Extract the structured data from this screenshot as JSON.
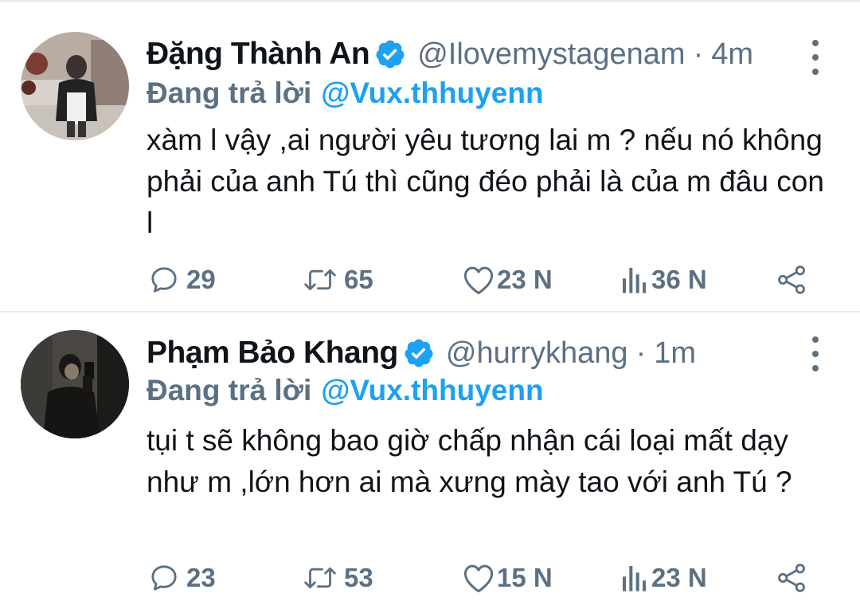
{
  "tweets": [
    {
      "display_name": "Đặng Thành An",
      "handle": "@Ilovemystagenam",
      "separator": "·",
      "time": "4m",
      "reply_label": "Đang trả lời",
      "reply_handle": "@Vux.thhuyenn",
      "text": "xàm l vậy ,ai người yêu tương lai m ? nếu nó không phải của anh Tú thì cũng đéo phải là của m đâu con l",
      "replies": "29",
      "retweets": "65",
      "likes": "23 N",
      "views": "36 N"
    },
    {
      "display_name": "Phạm Bảo Khang",
      "handle": "@hurrykhang",
      "separator": "·",
      "time": "1m",
      "reply_label": "Đang trả lời",
      "reply_handle": "@Vux.thhuyenn",
      "text": "tụi t sẽ không bao giờ chấp nhận cái loại mất dạy như m ,lớn hơn ai mà xưng mày tao với anh Tú ?",
      "replies": "23",
      "retweets": "53",
      "likes": "15 N",
      "views": "23 N"
    }
  ],
  "colors": {
    "verified": "#1da1f2",
    "link": "#1da1f2",
    "secondary": "#5b7083",
    "text": "#0f1419",
    "divider": "#e6ecf0"
  },
  "icons": [
    "verified-badge-icon",
    "more-vertical-icon",
    "reply-icon",
    "retweet-icon",
    "like-icon",
    "views-icon",
    "share-icon"
  ]
}
